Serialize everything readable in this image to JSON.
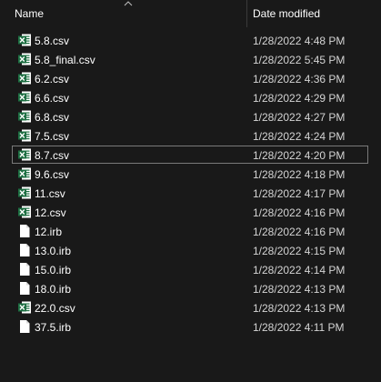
{
  "header": {
    "name_label": "Name",
    "date_label": "Date modified",
    "sort_icon": "chevron-up-icon"
  },
  "colors": {
    "background": "#191919",
    "excel_green": "#1d6f42",
    "generic_file": "#ffffff"
  },
  "files": [
    {
      "name": "5.8.csv",
      "date": "1/28/2022 4:48 PM",
      "icon": "excel-csv-icon"
    },
    {
      "name": "5.8_final.csv",
      "date": "1/28/2022 5:45 PM",
      "icon": "excel-csv-icon"
    },
    {
      "name": "6.2.csv",
      "date": "1/28/2022 4:36 PM",
      "icon": "excel-csv-icon"
    },
    {
      "name": "6.6.csv",
      "date": "1/28/2022 4:29 PM",
      "icon": "excel-csv-icon"
    },
    {
      "name": "6.8.csv",
      "date": "1/28/2022 4:27 PM",
      "icon": "excel-csv-icon"
    },
    {
      "name": "7.5.csv",
      "date": "1/28/2022 4:24 PM",
      "icon": "excel-csv-icon"
    },
    {
      "name": "8.7.csv",
      "date": "1/28/2022 4:20 PM",
      "icon": "excel-csv-icon",
      "focused": true
    },
    {
      "name": "9.6.csv",
      "date": "1/28/2022 4:18 PM",
      "icon": "excel-csv-icon"
    },
    {
      "name": "11.csv",
      "date": "1/28/2022 4:17 PM",
      "icon": "excel-csv-icon"
    },
    {
      "name": "12.csv",
      "date": "1/28/2022 4:16 PM",
      "icon": "excel-csv-icon"
    },
    {
      "name": "12.irb",
      "date": "1/28/2022 4:16 PM",
      "icon": "generic-file-icon"
    },
    {
      "name": "13.0.irb",
      "date": "1/28/2022 4:15 PM",
      "icon": "generic-file-icon"
    },
    {
      "name": "15.0.irb",
      "date": "1/28/2022 4:14 PM",
      "icon": "generic-file-icon"
    },
    {
      "name": "18.0.irb",
      "date": "1/28/2022 4:13 PM",
      "icon": "generic-file-icon"
    },
    {
      "name": "22.0.csv",
      "date": "1/28/2022 4:13 PM",
      "icon": "excel-csv-icon"
    },
    {
      "name": "37.5.irb",
      "date": "1/28/2022 4:11 PM",
      "icon": "generic-file-icon"
    }
  ]
}
